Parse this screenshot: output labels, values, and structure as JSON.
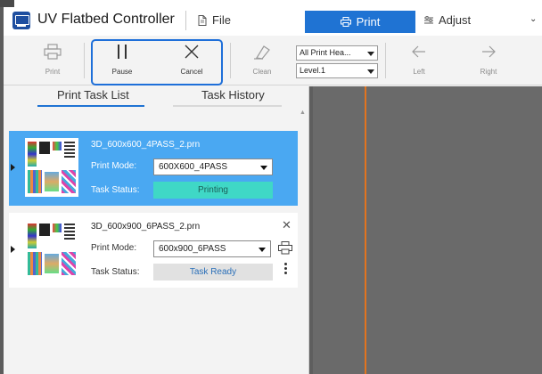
{
  "app": {
    "title": "UV Flatbed Controller"
  },
  "tabs": {
    "file": "File",
    "print": "Print",
    "adjust": "Adjust"
  },
  "toolbar": {
    "print": "Print",
    "pause": "Pause",
    "cancel": "Cancel",
    "clean": "Clean",
    "head_select": "All Print Hea...",
    "level_select": "Level.1",
    "left": "Left",
    "right": "Right"
  },
  "panel": {
    "tab_list": "Print Task List",
    "tab_history": "Task History"
  },
  "tasks": [
    {
      "name": "3D_600x600_4PASS_2.prn",
      "mode_label": "Print Mode:",
      "mode": "600X600_4PASS",
      "status_label": "Task Status:",
      "status": "Printing"
    },
    {
      "name": "3D_600x900_6PASS_2.prn",
      "mode_label": "Print Mode:",
      "mode": "600x900_6PASS",
      "status_label": "Task Status:",
      "status": "Task Ready"
    }
  ],
  "colors": {
    "accent": "#1f73d3",
    "selected_card": "#4aa8f2",
    "printing_badge": "#3fd8c6",
    "ready_badge": "#e1e1e1",
    "highlight_box": "#1e6fd9",
    "position_line": "#e2741f"
  },
  "icons": [
    "app-icon",
    "file-icon",
    "printer-icon",
    "adjust-icon",
    "pause-icon",
    "cancel-icon",
    "clean-icon",
    "arrow-left-icon",
    "arrow-right-icon",
    "close-icon",
    "kebab-icon"
  ]
}
